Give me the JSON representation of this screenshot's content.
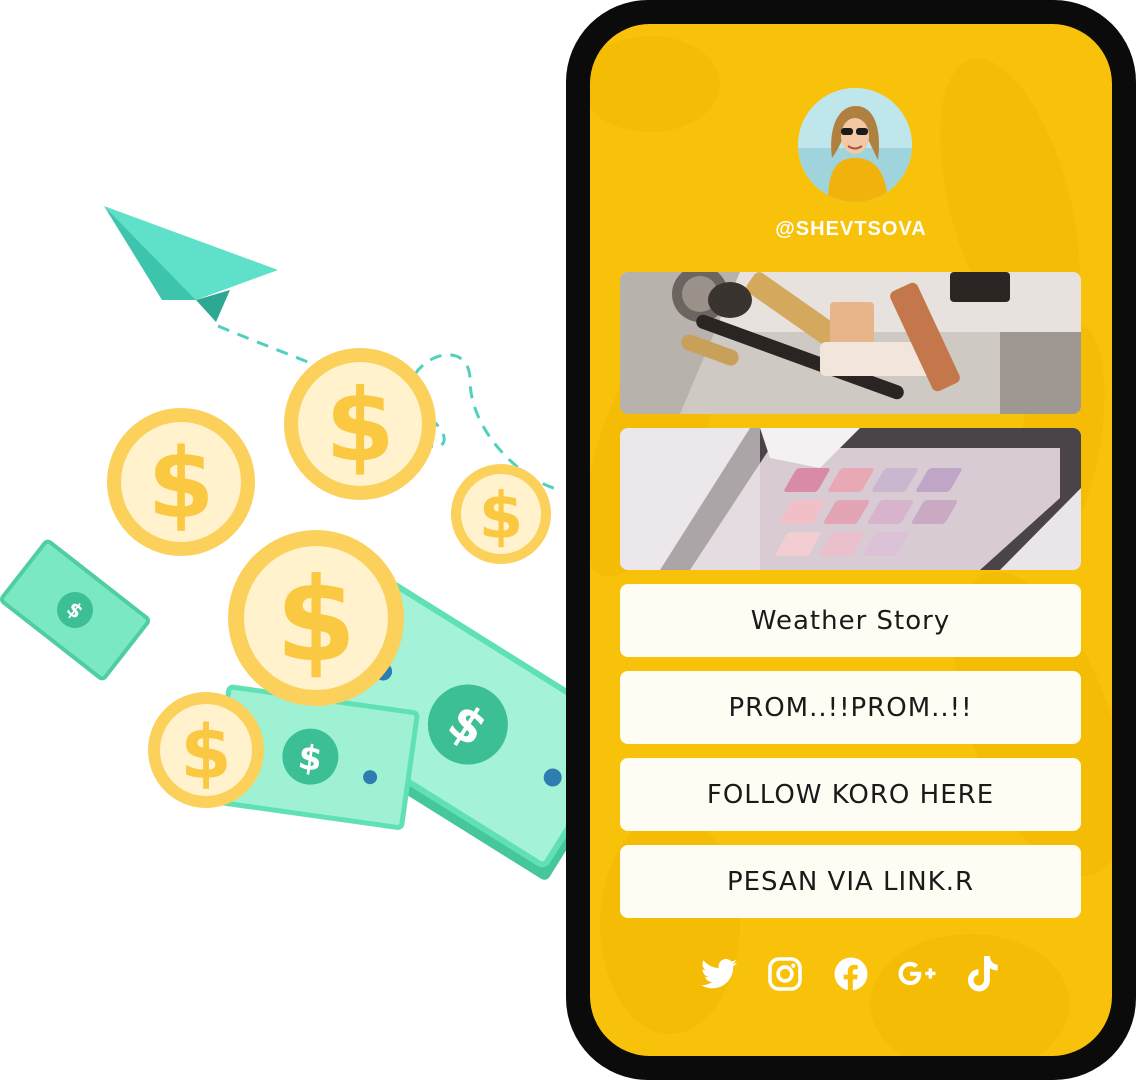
{
  "profile": {
    "username": "@SHEVTSOVA"
  },
  "links": [
    {
      "label": "Weather  Story"
    },
    {
      "label": "PROM..!!PROM..!!"
    },
    {
      "label": "FOLLOW KORO HERE"
    },
    {
      "label": "PESAN VIA LINK.R"
    }
  ],
  "social_icons": [
    "twitter-icon",
    "instagram-icon",
    "facebook-icon",
    "google-plus-icon",
    "tiktok-icon"
  ],
  "colors": {
    "phone_screen": "#f8c20a",
    "phone_frame": "#0b0b0b",
    "button_bg": "#fffdf3",
    "coin": "#f9c543",
    "money": "#5fe0b5",
    "plane": "#4fd8c0"
  }
}
